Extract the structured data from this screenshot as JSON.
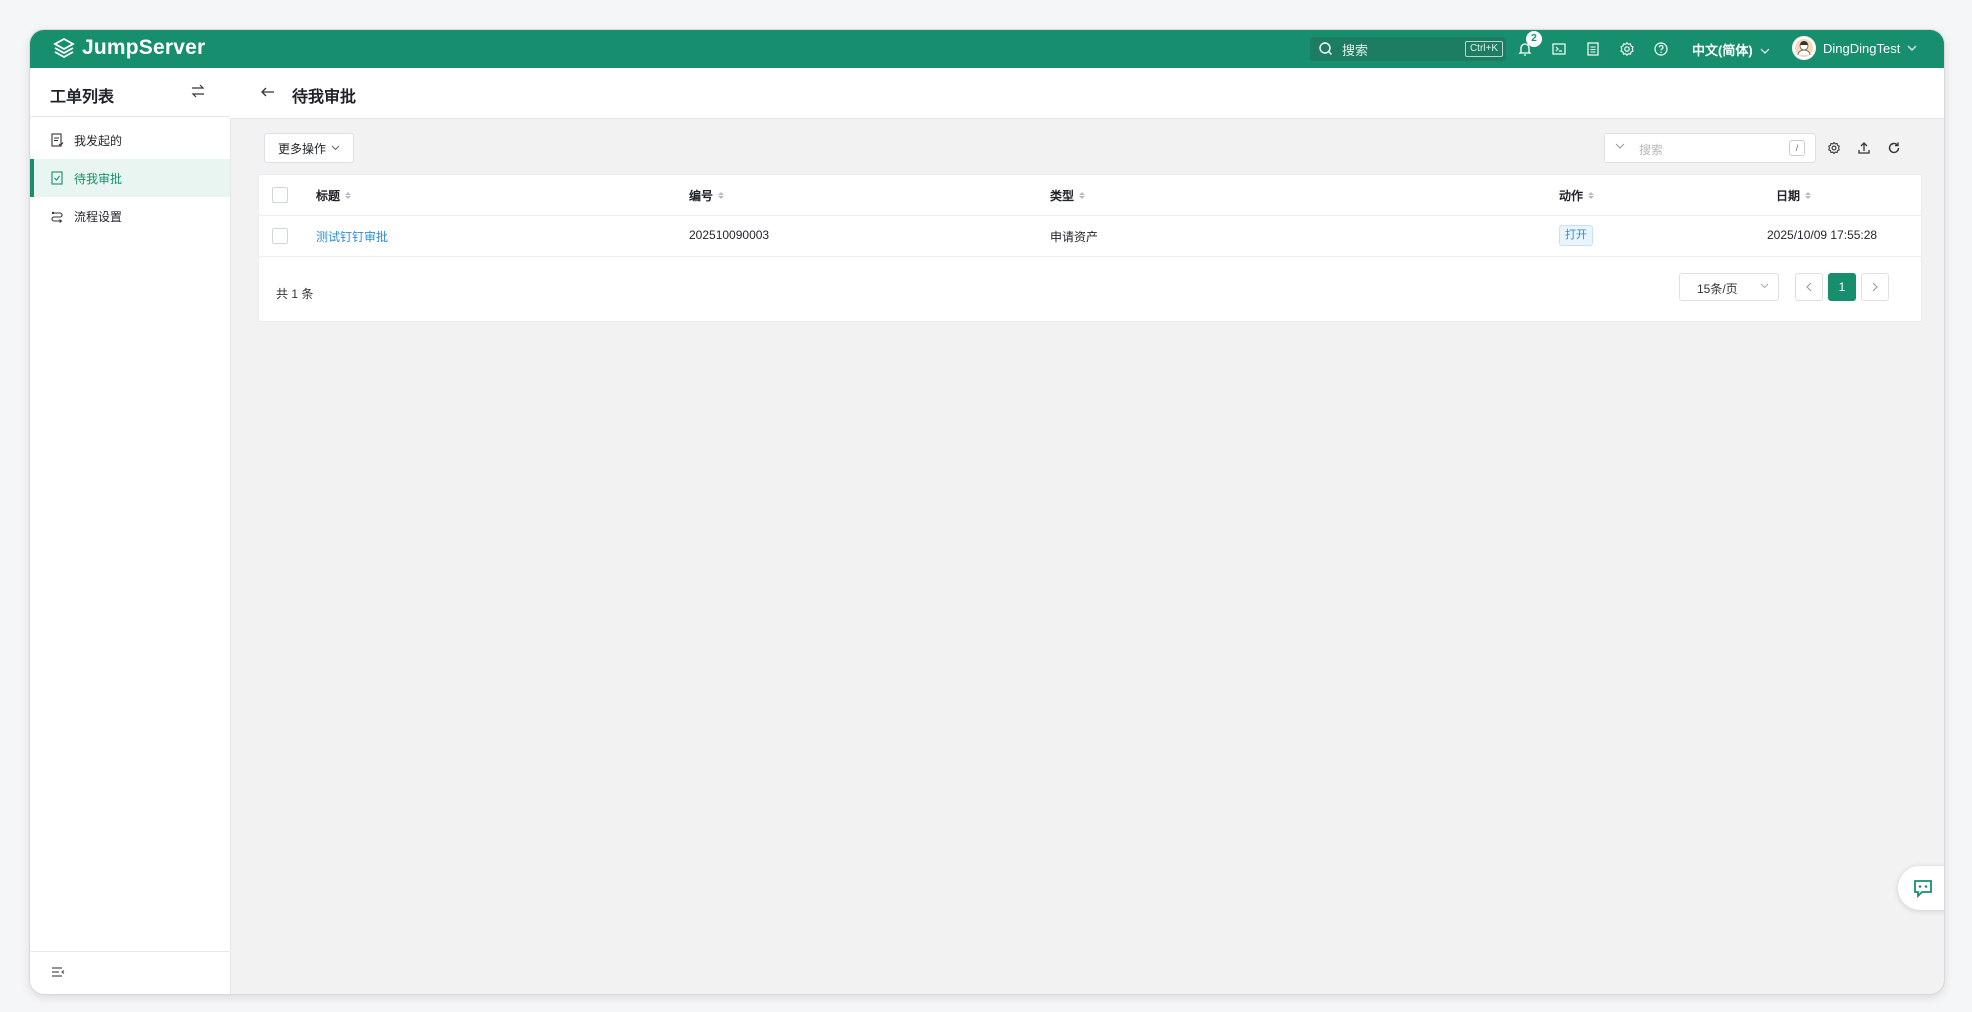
{
  "app": {
    "name": "JumpServer"
  },
  "topbar": {
    "search_placeholder": "搜索",
    "search_shortcut": "Ctrl+K",
    "notification_count": "2",
    "language": "中文(简体)",
    "username": "DingDingTest",
    "accent_color": "#178e6e"
  },
  "sidebar": {
    "title": "工单列表",
    "items": [
      {
        "label": "我发起的",
        "icon": "document-icon",
        "active": false
      },
      {
        "label": "待我审批",
        "icon": "approval-icon",
        "active": true
      },
      {
        "label": "流程设置",
        "icon": "flow-icon",
        "active": false
      }
    ]
  },
  "page": {
    "title": "待我审批"
  },
  "toolbar": {
    "more_actions": "更多操作",
    "search_placeholder": "搜索",
    "search_shortcut": "/"
  },
  "table": {
    "columns": [
      "标题",
      "编号",
      "类型",
      "动作",
      "日期"
    ],
    "rows": [
      {
        "title": "测试钉钉审批",
        "number": "202510090003",
        "type": "申请资产",
        "action": "打开",
        "date": "2025/10/09 17:55:28"
      }
    ],
    "total": "共 1 条",
    "page_size": "15条/页",
    "current_page": "1"
  }
}
